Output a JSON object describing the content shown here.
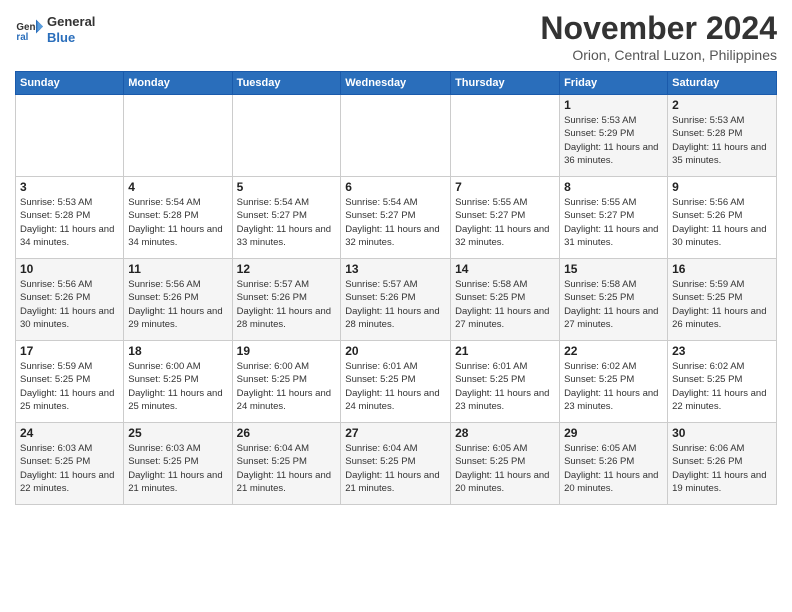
{
  "header": {
    "logo_general": "General",
    "logo_blue": "Blue",
    "title": "November 2024",
    "subtitle": "Orion, Central Luzon, Philippines"
  },
  "calendar": {
    "headers": [
      "Sunday",
      "Monday",
      "Tuesday",
      "Wednesday",
      "Thursday",
      "Friday",
      "Saturday"
    ],
    "rows": [
      [
        {
          "day": "",
          "info": ""
        },
        {
          "day": "",
          "info": ""
        },
        {
          "day": "",
          "info": ""
        },
        {
          "day": "",
          "info": ""
        },
        {
          "day": "",
          "info": ""
        },
        {
          "day": "1",
          "info": "Sunrise: 5:53 AM\nSunset: 5:29 PM\nDaylight: 11 hours and 36 minutes."
        },
        {
          "day": "2",
          "info": "Sunrise: 5:53 AM\nSunset: 5:28 PM\nDaylight: 11 hours and 35 minutes."
        }
      ],
      [
        {
          "day": "3",
          "info": "Sunrise: 5:53 AM\nSunset: 5:28 PM\nDaylight: 11 hours and 34 minutes."
        },
        {
          "day": "4",
          "info": "Sunrise: 5:54 AM\nSunset: 5:28 PM\nDaylight: 11 hours and 34 minutes."
        },
        {
          "day": "5",
          "info": "Sunrise: 5:54 AM\nSunset: 5:27 PM\nDaylight: 11 hours and 33 minutes."
        },
        {
          "day": "6",
          "info": "Sunrise: 5:54 AM\nSunset: 5:27 PM\nDaylight: 11 hours and 32 minutes."
        },
        {
          "day": "7",
          "info": "Sunrise: 5:55 AM\nSunset: 5:27 PM\nDaylight: 11 hours and 32 minutes."
        },
        {
          "day": "8",
          "info": "Sunrise: 5:55 AM\nSunset: 5:27 PM\nDaylight: 11 hours and 31 minutes."
        },
        {
          "day": "9",
          "info": "Sunrise: 5:56 AM\nSunset: 5:26 PM\nDaylight: 11 hours and 30 minutes."
        }
      ],
      [
        {
          "day": "10",
          "info": "Sunrise: 5:56 AM\nSunset: 5:26 PM\nDaylight: 11 hours and 30 minutes."
        },
        {
          "day": "11",
          "info": "Sunrise: 5:56 AM\nSunset: 5:26 PM\nDaylight: 11 hours and 29 minutes."
        },
        {
          "day": "12",
          "info": "Sunrise: 5:57 AM\nSunset: 5:26 PM\nDaylight: 11 hours and 28 minutes."
        },
        {
          "day": "13",
          "info": "Sunrise: 5:57 AM\nSunset: 5:26 PM\nDaylight: 11 hours and 28 minutes."
        },
        {
          "day": "14",
          "info": "Sunrise: 5:58 AM\nSunset: 5:25 PM\nDaylight: 11 hours and 27 minutes."
        },
        {
          "day": "15",
          "info": "Sunrise: 5:58 AM\nSunset: 5:25 PM\nDaylight: 11 hours and 27 minutes."
        },
        {
          "day": "16",
          "info": "Sunrise: 5:59 AM\nSunset: 5:25 PM\nDaylight: 11 hours and 26 minutes."
        }
      ],
      [
        {
          "day": "17",
          "info": "Sunrise: 5:59 AM\nSunset: 5:25 PM\nDaylight: 11 hours and 25 minutes."
        },
        {
          "day": "18",
          "info": "Sunrise: 6:00 AM\nSunset: 5:25 PM\nDaylight: 11 hours and 25 minutes."
        },
        {
          "day": "19",
          "info": "Sunrise: 6:00 AM\nSunset: 5:25 PM\nDaylight: 11 hours and 24 minutes."
        },
        {
          "day": "20",
          "info": "Sunrise: 6:01 AM\nSunset: 5:25 PM\nDaylight: 11 hours and 24 minutes."
        },
        {
          "day": "21",
          "info": "Sunrise: 6:01 AM\nSunset: 5:25 PM\nDaylight: 11 hours and 23 minutes."
        },
        {
          "day": "22",
          "info": "Sunrise: 6:02 AM\nSunset: 5:25 PM\nDaylight: 11 hours and 23 minutes."
        },
        {
          "day": "23",
          "info": "Sunrise: 6:02 AM\nSunset: 5:25 PM\nDaylight: 11 hours and 22 minutes."
        }
      ],
      [
        {
          "day": "24",
          "info": "Sunrise: 6:03 AM\nSunset: 5:25 PM\nDaylight: 11 hours and 22 minutes."
        },
        {
          "day": "25",
          "info": "Sunrise: 6:03 AM\nSunset: 5:25 PM\nDaylight: 11 hours and 21 minutes."
        },
        {
          "day": "26",
          "info": "Sunrise: 6:04 AM\nSunset: 5:25 PM\nDaylight: 11 hours and 21 minutes."
        },
        {
          "day": "27",
          "info": "Sunrise: 6:04 AM\nSunset: 5:25 PM\nDaylight: 11 hours and 21 minutes."
        },
        {
          "day": "28",
          "info": "Sunrise: 6:05 AM\nSunset: 5:25 PM\nDaylight: 11 hours and 20 minutes."
        },
        {
          "day": "29",
          "info": "Sunrise: 6:05 AM\nSunset: 5:26 PM\nDaylight: 11 hours and 20 minutes."
        },
        {
          "day": "30",
          "info": "Sunrise: 6:06 AM\nSunset: 5:26 PM\nDaylight: 11 hours and 19 minutes."
        }
      ]
    ]
  }
}
